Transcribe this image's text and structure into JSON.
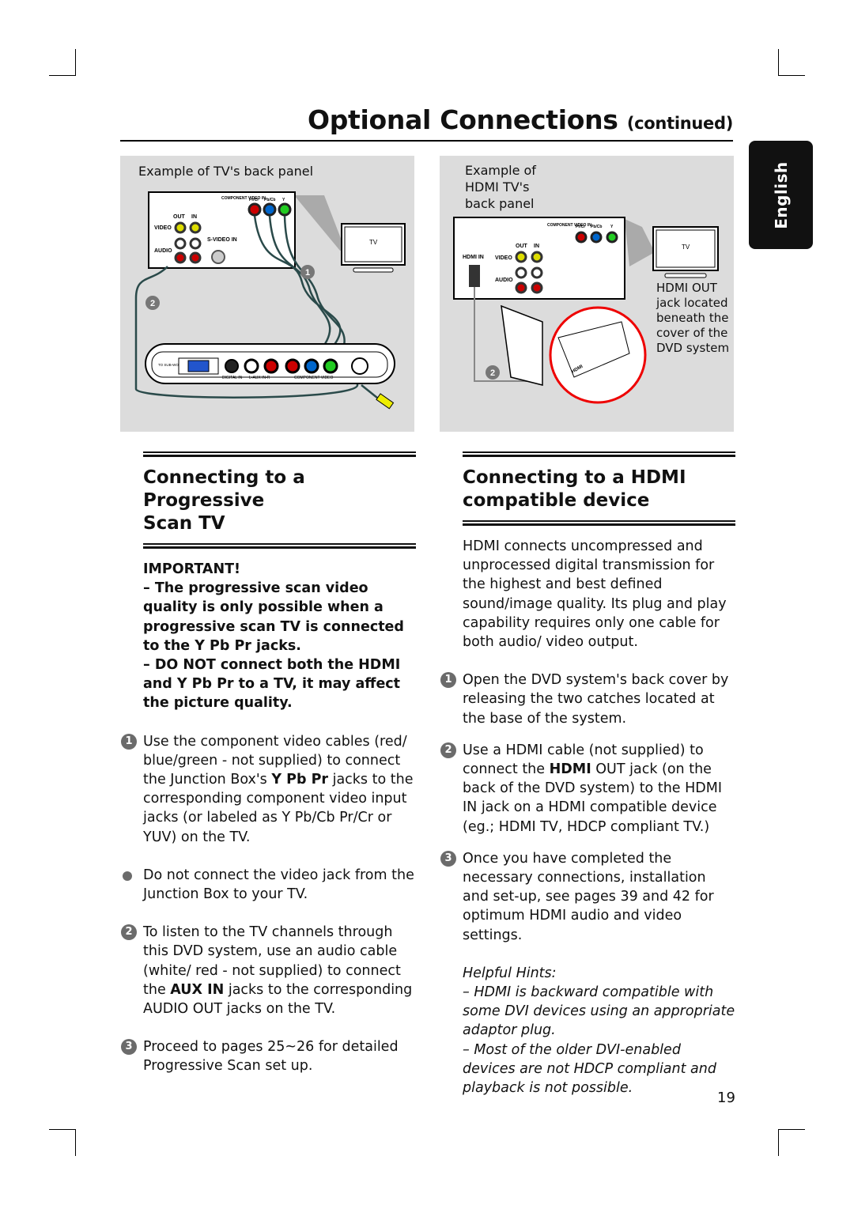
{
  "header": {
    "title": "Optional Connections",
    "title_suffix": "(continued)",
    "language_tab": "English"
  },
  "diagram_left": {
    "caption": "Example of TV's back panel",
    "labels": {
      "component_video_in": "COMPONENT VIDEO IN",
      "pr": "Pr/Cr",
      "pb": "Pb/Cb",
      "y": "Y",
      "out": "OUT",
      "in": "IN",
      "video": "VIDEO",
      "audio": "AUDIO",
      "svideo": "S-VIDEO IN",
      "tv": "TV",
      "step1": "1",
      "step2": "2",
      "subwoofer": "TO SUB-WOOFER",
      "digital_in": "DIGITAL IN",
      "aux_in": "L-AUX IN-R",
      "component_video": "COMPONENT VIDEO"
    }
  },
  "diagram_right": {
    "caption_lines": [
      "Example of",
      "HDMI TV's",
      "back panel"
    ],
    "labels": {
      "component_video_in": "COMPONENT VIDEO IN",
      "pr": "Pr/Cr",
      "pb": "Pb/Cb",
      "y": "Y",
      "out": "OUT",
      "in": "IN",
      "hdmi_in": "HDMI IN",
      "video": "VIDEO",
      "audio": "AUDIO",
      "tv": "TV",
      "step2": "2",
      "hdmi": "HDMI"
    },
    "note_lines": [
      "HDMI OUT",
      "jack located",
      "beneath the",
      "cover of the",
      "DVD system"
    ]
  },
  "left_section": {
    "heading_lines": [
      "Connecting to a Progressive",
      "Scan TV"
    ],
    "important_label": "IMPORTANT!",
    "important_1": "– The progressive scan video quality is only possible when a progressive scan TV is connected to the Y Pb Pr jacks.",
    "important_2": "– DO NOT connect both the HDMI and Y Pb Pr to a TV, it may affect the picture quality.",
    "steps": [
      {
        "marker": "1",
        "pre": "Use the component video cables (red/ blue/green - not supplied) to connect the Junction Box's ",
        "bold": "Y Pb Pr",
        "post": " jacks to the corresponding component video input jacks (or labeled as Y Pb/Cb Pr/Cr or YUV) on the TV."
      },
      {
        "marker": "bullet",
        "text": "Do not connect the video jack from the Junction Box to your TV."
      },
      {
        "marker": "2",
        "pre": "To listen to the TV channels through this DVD system, use an audio cable (white/ red - not supplied) to connect the ",
        "bold": "AUX IN",
        "post": " jacks to the corresponding AUDIO OUT jacks on the TV."
      },
      {
        "marker": "3",
        "text": "Proceed to pages 25~26 for detailed Progressive Scan set up."
      }
    ]
  },
  "right_section": {
    "heading_lines": [
      "Connecting to a HDMI",
      "compatible device"
    ],
    "intro": "HDMI connects uncompressed and unprocessed digital transmission for the highest and best defined sound/image quality. Its plug and play capability requires only one cable for both audio/ video output.",
    "steps": [
      {
        "marker": "1",
        "text": "Open the DVD system's back cover by releasing the two catches located at the base of the system."
      },
      {
        "marker": "2",
        "pre": "Use a HDMI cable (not supplied) to connect the ",
        "bold": "HDMI",
        "post": " OUT jack (on the back of the DVD system) to the HDMI IN jack on a HDMI compatible device (eg.; HDMI TV, HDCP compliant TV.)"
      },
      {
        "marker": "3",
        "text": "Once you have completed the necessary connections, installation and set-up, see pages 39 and 42 for optimum HDMI audio and video settings."
      }
    ],
    "hints_title": "Helpful Hints:",
    "hints": [
      "– HDMI is backward compatible with some DVI devices using an appropriate adaptor plug.",
      "– Most of the older DVI-enabled devices are not HDCP compliant and playback is not possible."
    ]
  },
  "footer": {
    "page_number": "19"
  }
}
